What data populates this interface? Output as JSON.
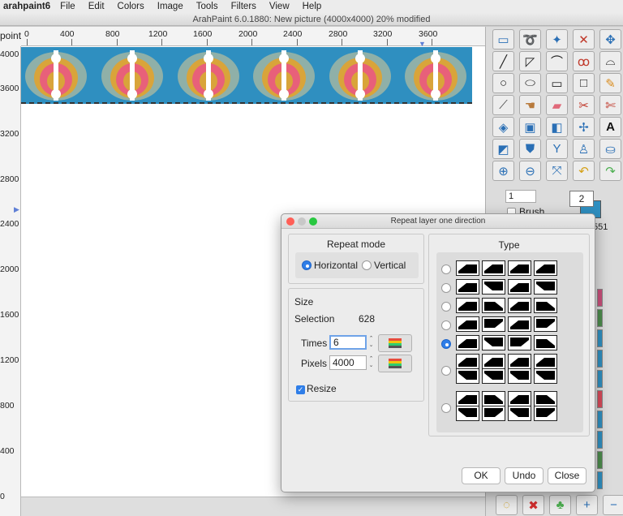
{
  "menubar": {
    "app_name": "arahpaint6",
    "items": [
      "File",
      "Edit",
      "Colors",
      "Image",
      "Tools",
      "Filters",
      "View",
      "Help"
    ]
  },
  "window": {
    "title": "ArahPaint 6.0.1880: New picture  (4000x4000) 20% modified"
  },
  "ruler": {
    "unit": "point",
    "top_labels": [
      "0",
      "400",
      "800",
      "1200",
      "1600",
      "2000",
      "2400",
      "2800",
      "3200",
      "3600"
    ],
    "left_labels": [
      "4000",
      "3600",
      "3200",
      "2800",
      "2400",
      "2000",
      "1600",
      "1200",
      "800",
      "400",
      "0"
    ]
  },
  "toolbox": {
    "tools": [
      "select-rect-icon",
      "lasso-icon",
      "magic-wand-icon",
      "crop-icon",
      "move-icon",
      "line-icon",
      "polygon-icon",
      "curve-icon",
      "freehand-icon",
      "bezier-icon",
      "ellipse-circle-icon",
      "ellipse-icon",
      "rectangle-icon",
      "square-icon",
      "pencil-icon",
      "eyedropper-icon",
      "smudge-icon",
      "eraser-icon",
      "scissors-icon",
      "cut-icon",
      "fill-icon",
      "stamp-icon",
      "mirror-icon",
      "pattern-icon",
      "text-icon",
      "transform-icon",
      "shape-icon",
      "filter-icon",
      "pen-icon",
      "bucket-icon",
      "zoom-in-icon",
      "zoom-out-icon",
      "fit-icon",
      "undo-icon",
      "redo-icon"
    ],
    "spin_value": "1",
    "brush_size": "2",
    "brush_label": "Brush",
    "side_number": "551",
    "bottom_tools": [
      "lightbulb-icon",
      "delete-icon",
      "tree-icon",
      "add-icon",
      "remove-icon"
    ]
  },
  "dialog": {
    "title": "Repeat layer one direction",
    "repeat_mode": {
      "title": "Repeat mode",
      "options": [
        "Horizontal",
        "Vertical"
      ],
      "selected": "Horizontal"
    },
    "size": {
      "title": "Size",
      "selection_label": "Selection",
      "selection_value": "628",
      "times_label": "Times",
      "times_value": "6",
      "pixels_label": "Pixels",
      "pixels_value": "4000",
      "resize_label": "Resize",
      "resize_checked": true
    },
    "type": {
      "title": "Type",
      "selected_row": 4
    },
    "buttons": {
      "ok": "OK",
      "undo": "Undo",
      "close": "Close"
    }
  },
  "colors": {
    "pattern_bg": "#2f8fc0",
    "accent": "#2f7ee8"
  }
}
